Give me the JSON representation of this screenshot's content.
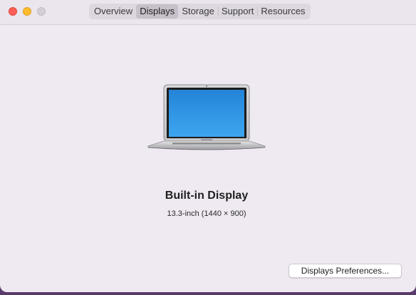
{
  "tabs": [
    {
      "label": "Overview",
      "active": false
    },
    {
      "label": "Displays",
      "active": true
    },
    {
      "label": "Storage",
      "active": false
    },
    {
      "label": "Support",
      "active": false
    },
    {
      "label": "Resources",
      "active": false
    }
  ],
  "display": {
    "name": "Built-in Display",
    "spec": "13.3-inch (1440 × 900)",
    "image_icon": "macbook-air-icon"
  },
  "buttons": {
    "display_preferences": "Displays Preferences..."
  },
  "colors": {
    "window_bg": "#efe9f1",
    "close": "#fe5f57",
    "minimize": "#febc2e",
    "zoom_inactive": "#d3ced5",
    "screen_blue": "#2f95e6"
  }
}
